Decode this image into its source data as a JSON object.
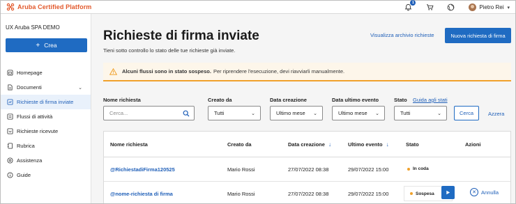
{
  "app": {
    "brand": "Aruba Certified Platform",
    "accent": "#1f6bc2",
    "brand_color": "#e2592c"
  },
  "header": {
    "notifications_count": "1",
    "icons": [
      "bell-icon",
      "cart-icon",
      "globe-icon"
    ],
    "user_name": "Pietro Rei"
  },
  "sidebar": {
    "company": "UX Aruba SPA DEMO",
    "create_label": "Crea",
    "items": [
      {
        "label": "Homepage",
        "icon": "home-icon"
      },
      {
        "label": "Documenti",
        "icon": "document-icon"
      },
      {
        "label": "Richieste di firma inviate",
        "icon": "signature-icon",
        "active": true
      },
      {
        "label": "Flussi di attività",
        "icon": "flow-icon"
      },
      {
        "label": "Richieste ricevute",
        "icon": "inbox-icon"
      },
      {
        "label": "Rubrica",
        "icon": "address-book-icon"
      },
      {
        "label": "Assistenza",
        "icon": "help-icon"
      },
      {
        "label": "Guide",
        "icon": "guide-icon"
      }
    ]
  },
  "main": {
    "title": "Richieste di firma inviate",
    "subtitle": "Tieni sotto controllo lo stato delle tue richieste già inviate.",
    "archive_link": "Visualizza archivio richieste",
    "new_request_button": "Nuova richiesta di firma",
    "alert": {
      "bold": "Alcuni flussi sono in stato sospeso.",
      "text": "Per riprendere l'esecuzione, devi riavviarli manualmente."
    },
    "filters": {
      "name_label": "Nome richiesta",
      "name_placeholder": "Cerca...",
      "created_by_label": "Creato da",
      "created_by_value": "Tutti",
      "creation_date_label": "Data creazione",
      "creation_date_value": "Ultimo mese",
      "last_event_label": "Data ultimo evento",
      "last_event_value": "Ultimo mese",
      "state_label": "Stato",
      "state_guide_link": "Guida agli stati",
      "state_value": "Tutti",
      "search_button": "Cerca",
      "reset_link": "Azzera"
    },
    "table": {
      "columns": [
        "Nome richiesta",
        "Creato da",
        "Data creazione",
        "Ultimo evento",
        "Stato",
        "Azioni"
      ],
      "rows": [
        {
          "name": "@RichiestadiFirma120525",
          "created_by": "Mario Rossi",
          "created": "27/07/2022 08:38",
          "last_event": "29/07/2022 15:00",
          "state": "In coda"
        },
        {
          "name": "@nome-richiesta di firma",
          "created_by": "Mario Rossi",
          "created": "27/07/2022 08:38",
          "last_event": "29/07/2022 15:00",
          "state": "Sospesa",
          "action": "Annulla"
        }
      ]
    }
  }
}
